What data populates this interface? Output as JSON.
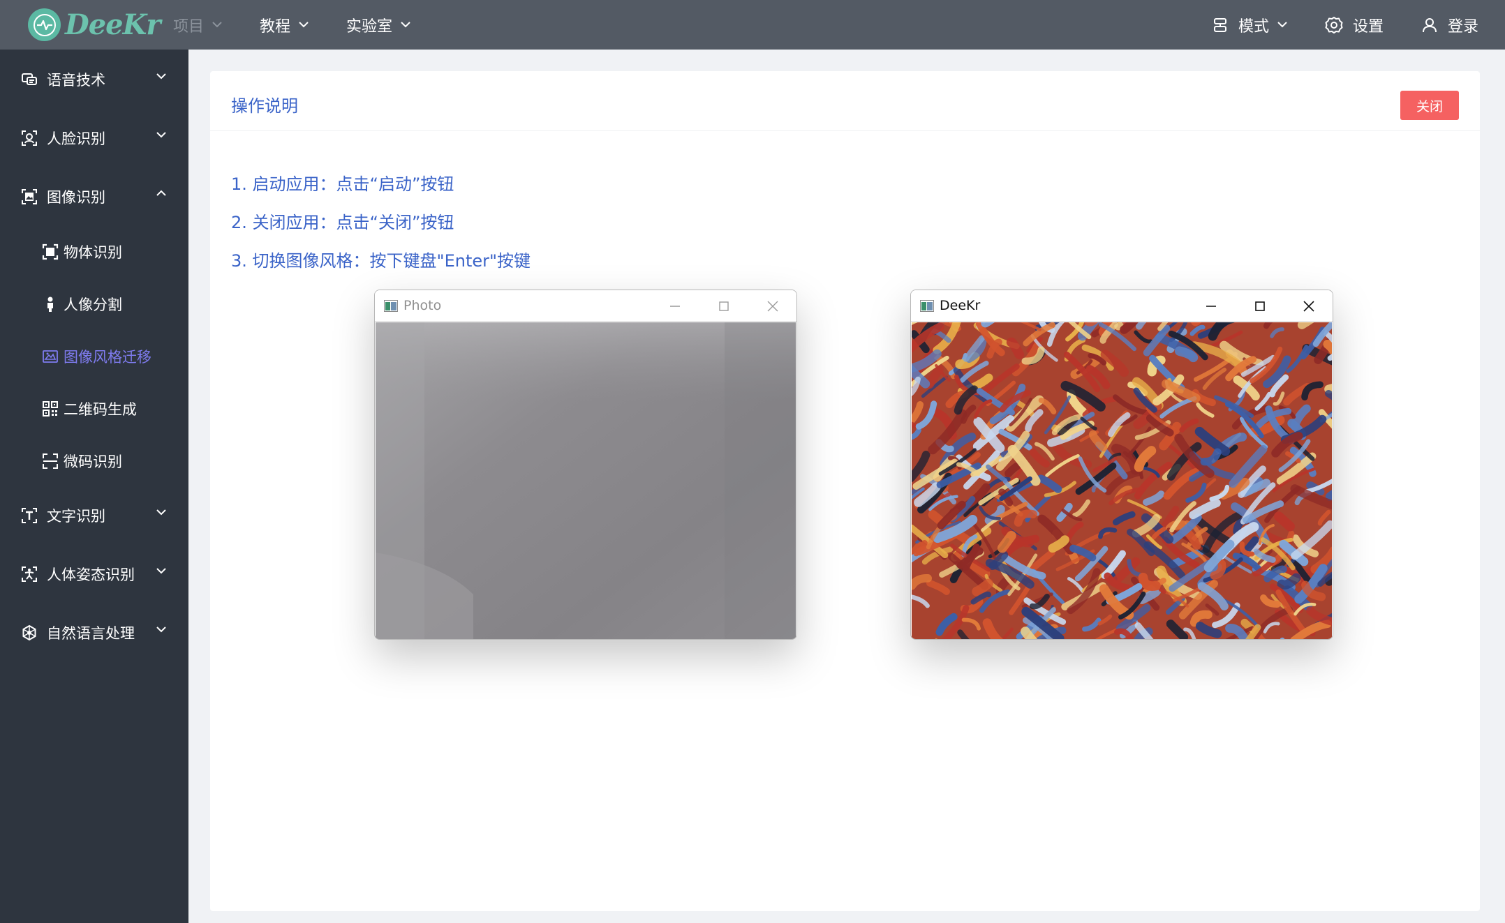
{
  "app": {
    "brand": "DeeKr",
    "colors": {
      "topbar": "#535a64",
      "sidebar": "#2e353f",
      "accent": "#3a63c8",
      "active_menu": "#7f7cf0",
      "danger": "#f56161",
      "logo": "#5bb9a3"
    }
  },
  "topnav": {
    "items": [
      {
        "label": "项目",
        "disabled": true,
        "icon": "chevron-down-icon"
      },
      {
        "label": "教程",
        "disabled": false,
        "icon": "chevron-down-icon"
      },
      {
        "label": "实验室",
        "disabled": false,
        "icon": "chevron-down-icon"
      }
    ],
    "right": {
      "mode": {
        "label": "模式",
        "icon": "mode-icon"
      },
      "settings": {
        "label": "设置",
        "icon": "gear-icon"
      },
      "login": {
        "label": "登录",
        "icon": "user-icon"
      }
    }
  },
  "sidebar": {
    "items": [
      {
        "label": "语音技术",
        "icon": "speech-icon",
        "expanded": false
      },
      {
        "label": "人脸识别",
        "icon": "face-icon",
        "expanded": false
      },
      {
        "label": "图像识别",
        "icon": "image-scan-icon",
        "expanded": true
      },
      {
        "label": "文字识别",
        "icon": "text-icon",
        "expanded": false
      },
      {
        "label": "人体姿态识别",
        "icon": "pose-icon",
        "expanded": false
      },
      {
        "label": "自然语言处理",
        "icon": "nlp-icon",
        "expanded": false
      }
    ],
    "sub_items": [
      {
        "label": "物体识别",
        "icon": "object-scan-icon",
        "active": false
      },
      {
        "label": "人像分割",
        "icon": "person-icon",
        "active": false
      },
      {
        "label": "图像风格迁移",
        "icon": "style-transfer-icon",
        "active": true
      },
      {
        "label": "二维码生成",
        "icon": "qrcode-icon",
        "active": false
      },
      {
        "label": "微码识别",
        "icon": "scan-frame-icon",
        "active": false
      }
    ]
  },
  "main": {
    "title": "操作说明",
    "close_label": "关闭",
    "instructions": [
      "1. 启动应用：点击“启动”按钮",
      "2. 关闭应用：点击“关闭”按钮",
      "3. 切换图像风格：按下键盘\"Enter\"按键"
    ]
  },
  "windows": {
    "photo": {
      "title": "Photo",
      "active": false
    },
    "deekr": {
      "title": "DeeKr",
      "active": true
    }
  }
}
